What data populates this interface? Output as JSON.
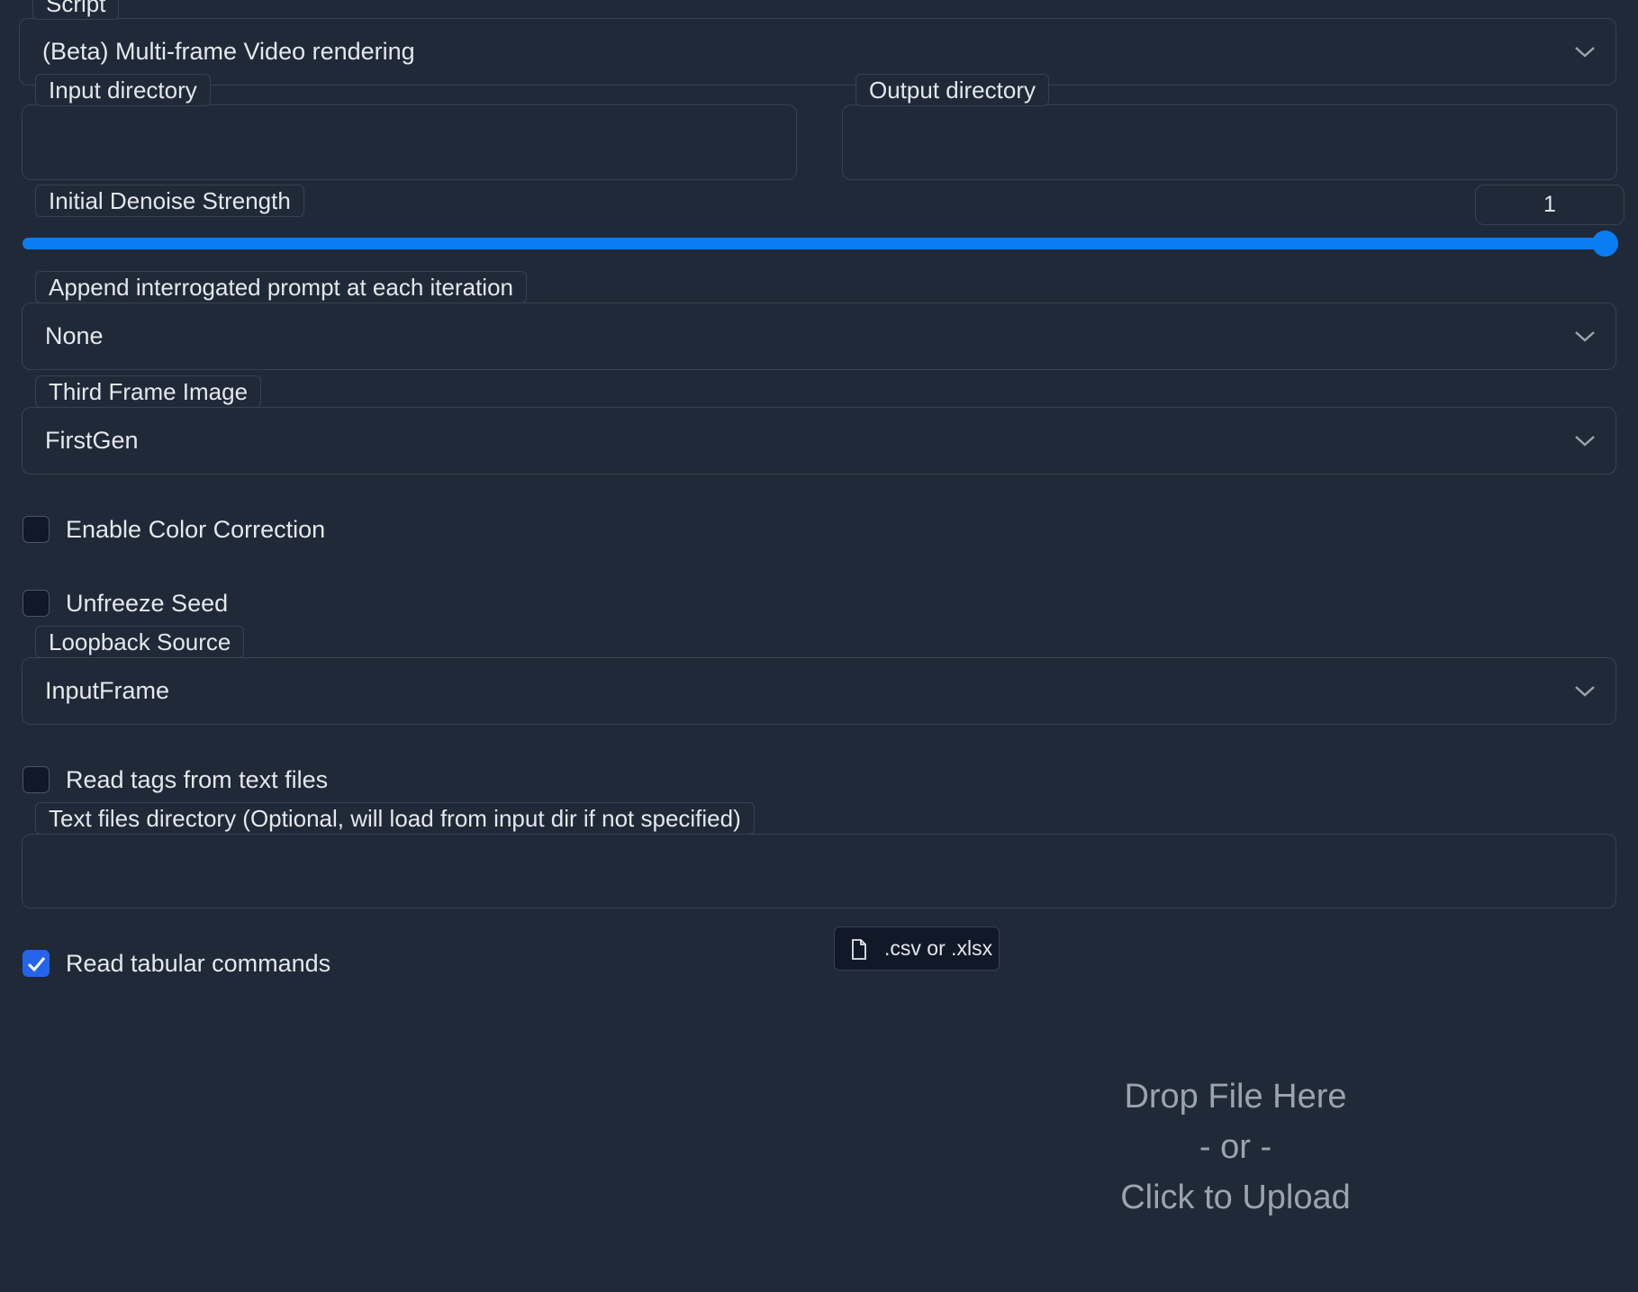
{
  "script": {
    "label": "Script",
    "selected": "(Beta) Multi-frame Video rendering"
  },
  "input_directory": {
    "label": "Input directory",
    "value": ""
  },
  "output_directory": {
    "label": "Output directory",
    "value": ""
  },
  "denoise": {
    "label": "Initial Denoise Strength",
    "value": "1",
    "level_fraction": 1.0
  },
  "append_prompt": {
    "label": "Append interrogated prompt at each iteration",
    "selected": "None"
  },
  "third_frame": {
    "label": "Third Frame Image",
    "selected": "FirstGen"
  },
  "color_correction": {
    "label": "Enable Color Correction",
    "checked": false
  },
  "unfreeze_seed": {
    "label": "Unfreeze Seed",
    "checked": false
  },
  "loopback_source": {
    "label": "Loopback Source",
    "selected": "InputFrame"
  },
  "read_tags": {
    "label": "Read tags from text files",
    "checked": false
  },
  "text_files_dir": {
    "label": "Text files directory (Optional, will load from input dir if not specified)",
    "value": ""
  },
  "read_tabular": {
    "label": "Read tabular commands",
    "checked": true
  },
  "file_upload": {
    "file_types": ".csv or .xlsx",
    "icon": "file-icon",
    "drop_line1": "Drop File Here",
    "drop_line2": "- or -",
    "drop_line3": "Click to Upload"
  },
  "colors": {
    "background": "#1f2937",
    "accent": "#0a7df2",
    "checkbox_checked": "#2563eb",
    "border": "#374151"
  }
}
